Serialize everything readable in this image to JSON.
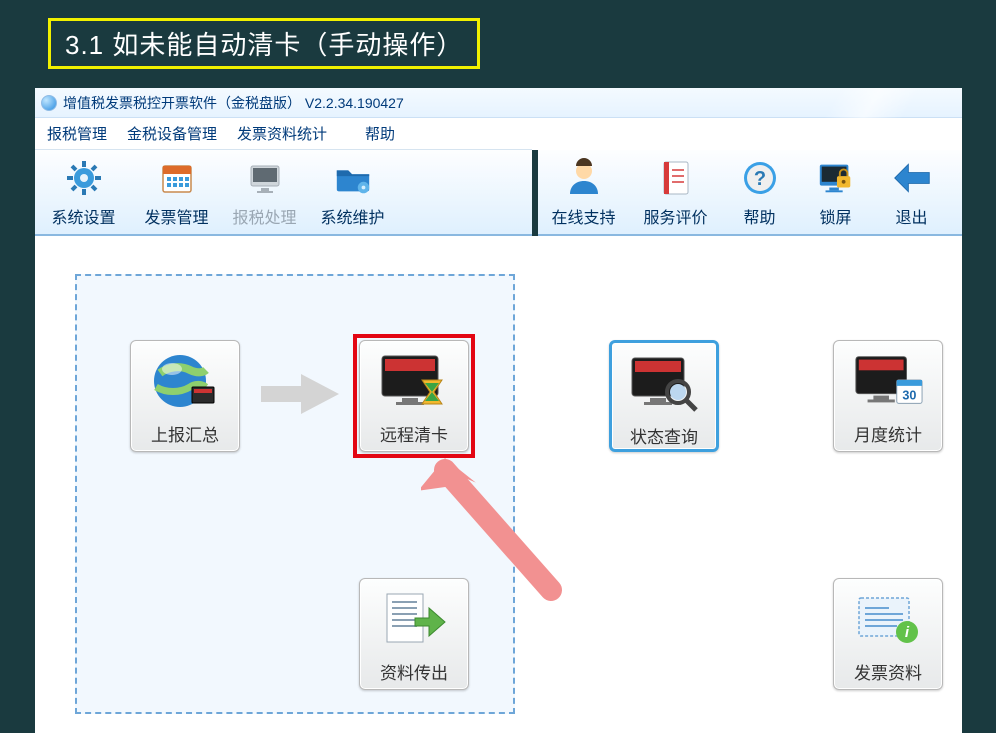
{
  "slide": {
    "title": "3.1 如未能自动清卡（手动操作）"
  },
  "window": {
    "title": "增值税发票税控开票软件（金税盘版） V2.2.34.190427"
  },
  "menubar": {
    "items": [
      {
        "label": "报税管理"
      },
      {
        "label": "金税设备管理"
      },
      {
        "label": "发票资料统计"
      },
      {
        "label": "帮助"
      }
    ]
  },
  "toolbar_left": {
    "items": [
      {
        "name": "system-settings",
        "label": "系统设置",
        "icon": "gear-icon"
      },
      {
        "name": "invoice-mgmt",
        "label": "发票管理",
        "icon": "calendar-icon"
      },
      {
        "name": "tax-process",
        "label": "报税处理",
        "icon": "monitor-icon",
        "disabled": true
      },
      {
        "name": "system-maint",
        "label": "系统维护",
        "icon": "folder-gear-icon"
      }
    ]
  },
  "toolbar_right": {
    "items": [
      {
        "name": "online-support",
        "label": "在线支持",
        "icon": "person-icon"
      },
      {
        "name": "service-review",
        "label": "服务评价",
        "icon": "notebook-icon"
      },
      {
        "name": "help",
        "label": "帮助",
        "icon": "help-icon"
      },
      {
        "name": "lock-screen",
        "label": "锁屏",
        "icon": "lock-screen-icon"
      },
      {
        "name": "exit",
        "label": "退出",
        "icon": "back-arrow-icon"
      }
    ]
  },
  "tiles": {
    "report_summary": {
      "label": "上报汇总"
    },
    "remote_clear": {
      "label": "远程清卡"
    },
    "data_export": {
      "label": "资料传出"
    },
    "status_query": {
      "label": "状态查询"
    },
    "monthly_stats": {
      "label": "月度统计",
      "badge": "30"
    },
    "invoice_data": {
      "label": "发票资料"
    }
  }
}
